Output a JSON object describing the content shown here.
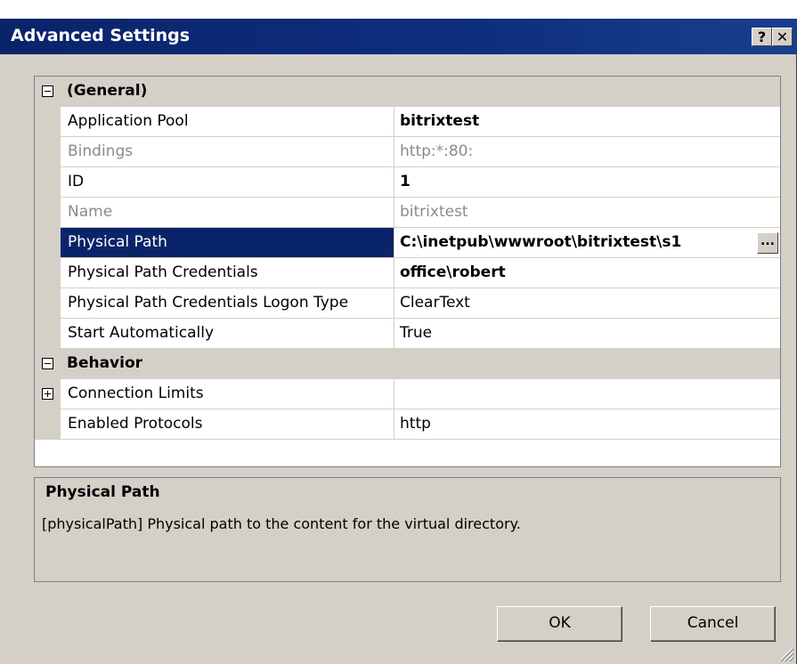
{
  "window": {
    "title": "Advanced Settings",
    "help_label": "?",
    "close_label": "✕"
  },
  "grid": {
    "general": {
      "label": "(General)",
      "rows": [
        {
          "name": "Application Pool",
          "value": "bitrixtest"
        },
        {
          "name": "Bindings",
          "value": "http:*:80:"
        },
        {
          "name": "ID",
          "value": "1"
        },
        {
          "name": "Name",
          "value": "bitrixtest"
        },
        {
          "name": "Physical Path",
          "value": "C:\\inetpub\\wwwroot\\bitrixtest\\s1"
        },
        {
          "name": "Physical Path Credentials",
          "value": "office\\robert"
        },
        {
          "name": "Physical Path Credentials Logon Type",
          "value": "ClearText"
        },
        {
          "name": "Start Automatically",
          "value": "True"
        }
      ]
    },
    "behavior": {
      "label": "Behavior",
      "rows": [
        {
          "name": "Connection Limits",
          "value": ""
        },
        {
          "name": "Enabled Protocols",
          "value": "http"
        }
      ]
    },
    "ellipsis_label": "..."
  },
  "description": {
    "title": "Physical Path",
    "text": "[physicalPath] Physical path to the content for the virtual directory."
  },
  "buttons": {
    "ok": "OK",
    "cancel": "Cancel"
  },
  "colors": {
    "title_bar": "#0a246a",
    "selection": "#0a246a",
    "face": "#d4d0c8"
  }
}
